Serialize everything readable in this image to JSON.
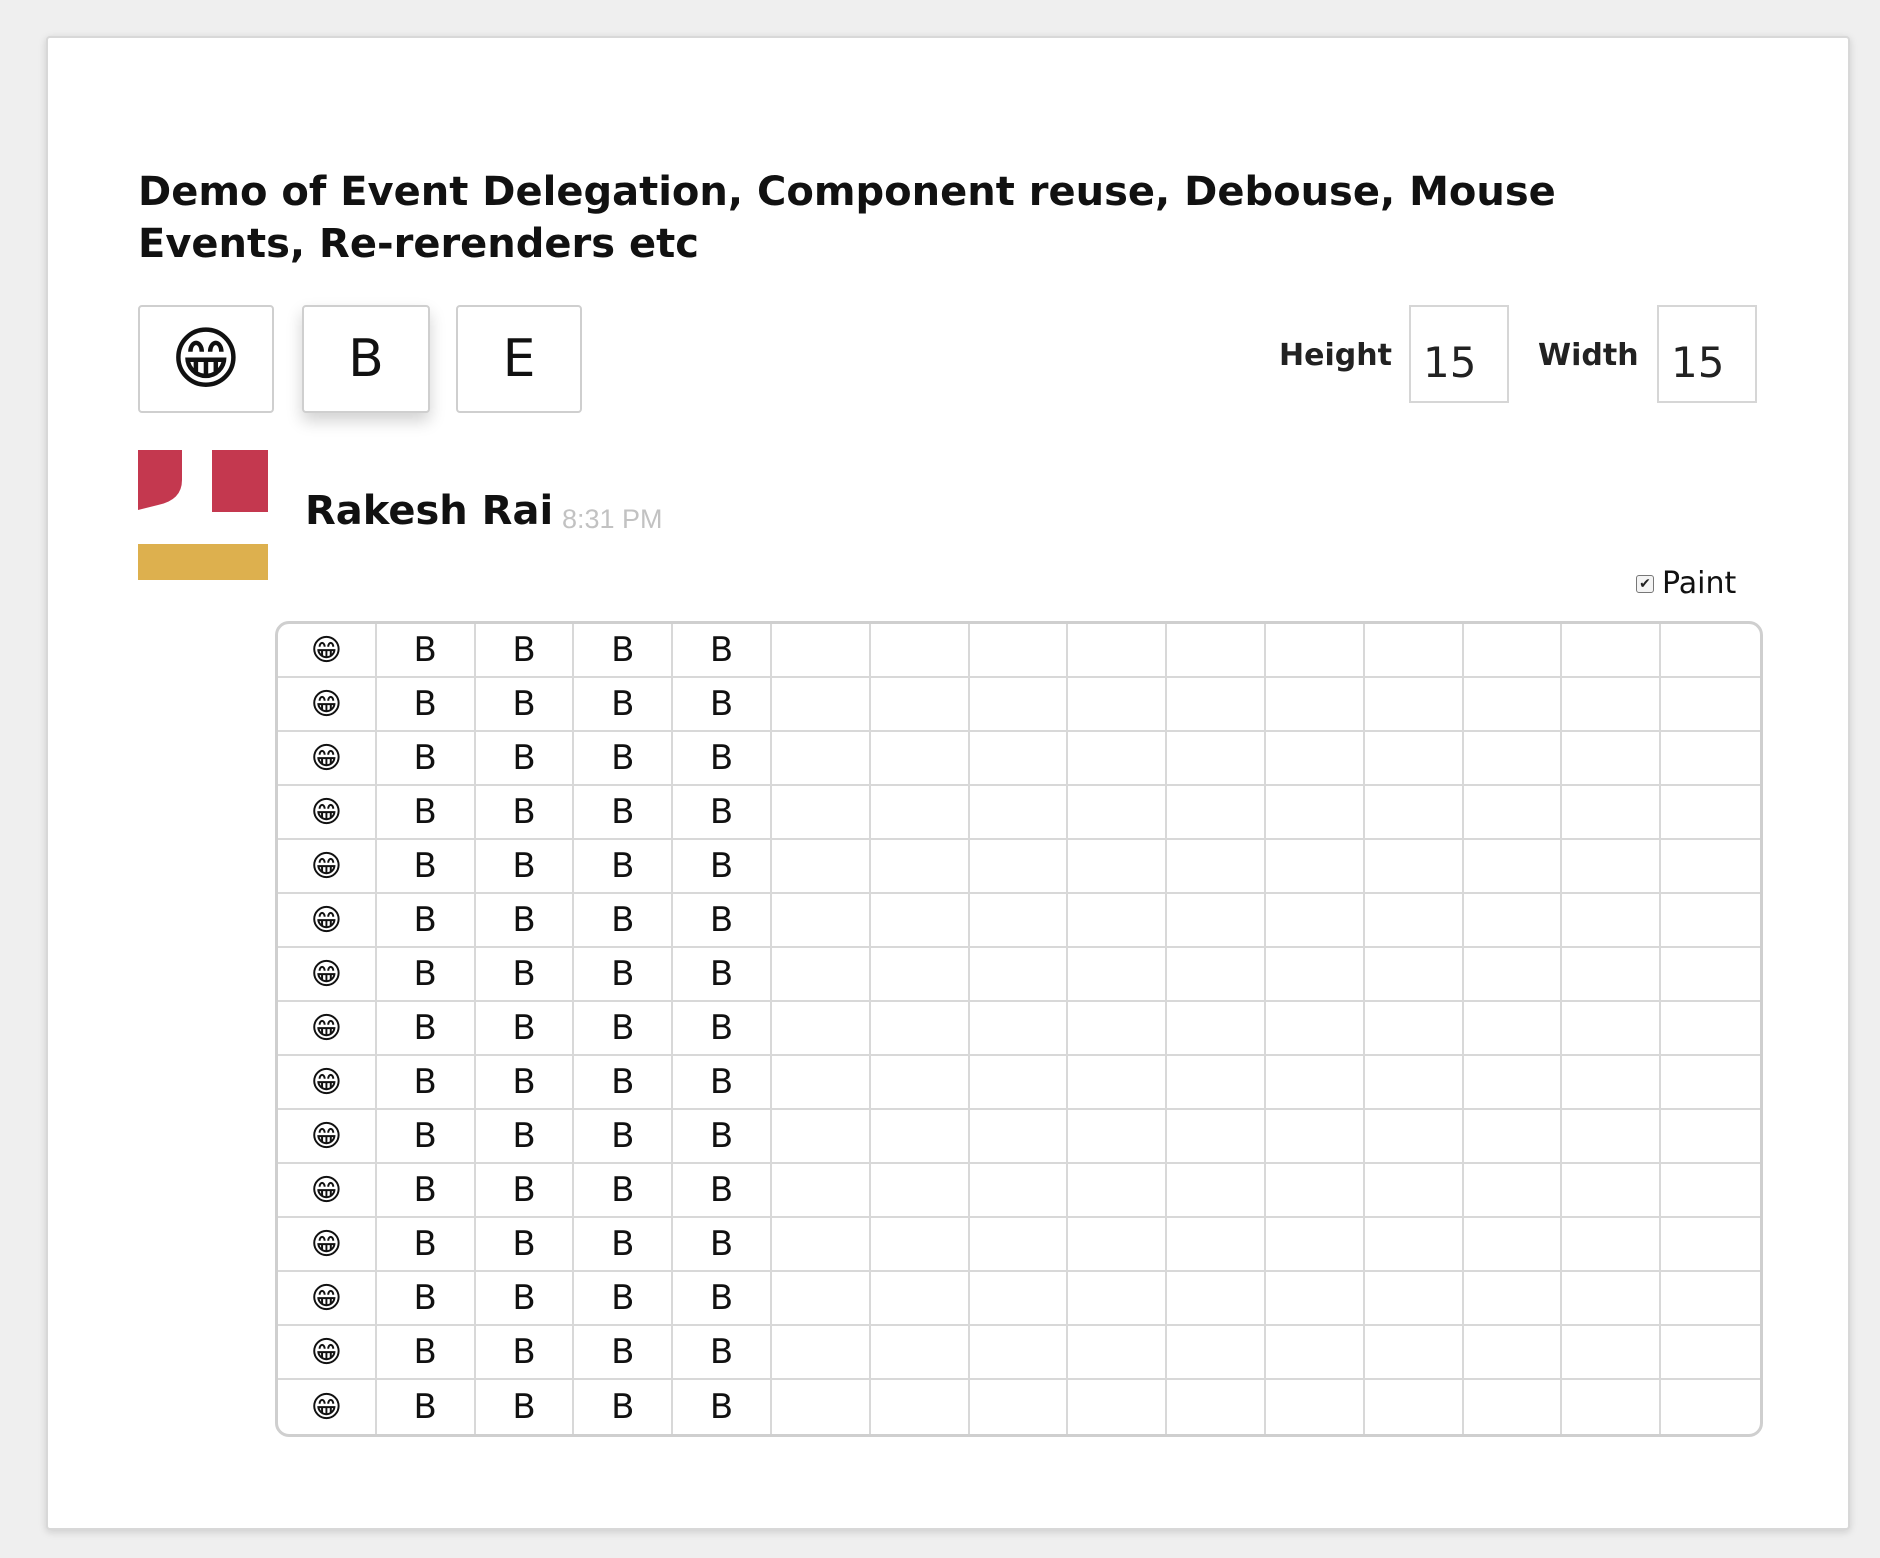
{
  "page": {
    "title": "Demo of Event Delegation, Component reuse, Debouse, Mouse Events, Re-rerenders etc"
  },
  "toolbar": {
    "emoji_label": "😁",
    "b_label": "B",
    "e_label": "E"
  },
  "dimensions": {
    "height_label": "Height",
    "height_value": "15",
    "width_label": "Width",
    "width_value": "15"
  },
  "message": {
    "user_name": "Rakesh Rai",
    "timestamp": "8:31 PM"
  },
  "paint": {
    "label": "Paint",
    "checked": true
  },
  "grid": {
    "rows": 15,
    "cols": 15,
    "cells": [
      [
        "😁",
        "B",
        "B",
        "B",
        "B",
        "",
        "",
        "",
        "",
        "",
        "",
        "",
        "",
        "",
        ""
      ],
      [
        "😁",
        "B",
        "B",
        "B",
        "B",
        "",
        "",
        "",
        "",
        "",
        "",
        "",
        "",
        "",
        ""
      ],
      [
        "😁",
        "B",
        "B",
        "B",
        "B",
        "",
        "",
        "",
        "",
        "",
        "",
        "",
        "",
        "",
        ""
      ],
      [
        "😁",
        "B",
        "B",
        "B",
        "B",
        "",
        "",
        "",
        "",
        "",
        "",
        "",
        "",
        "",
        ""
      ],
      [
        "😁",
        "B",
        "B",
        "B",
        "B",
        "",
        "",
        "",
        "",
        "",
        "",
        "",
        "",
        "",
        ""
      ],
      [
        "😁",
        "B",
        "B",
        "B",
        "B",
        "",
        "",
        "",
        "",
        "",
        "",
        "",
        "",
        "",
        ""
      ],
      [
        "😁",
        "B",
        "B",
        "B",
        "B",
        "",
        "",
        "",
        "",
        "",
        "",
        "",
        "",
        "",
        ""
      ],
      [
        "😁",
        "B",
        "B",
        "B",
        "B",
        "",
        "",
        "",
        "",
        "",
        "",
        "",
        "",
        "",
        ""
      ],
      [
        "😁",
        "B",
        "B",
        "B",
        "B",
        "",
        "",
        "",
        "",
        "",
        "",
        "",
        "",
        "",
        ""
      ],
      [
        "😁",
        "B",
        "B",
        "B",
        "B",
        "",
        "",
        "",
        "",
        "",
        "",
        "",
        "",
        "",
        ""
      ],
      [
        "😁",
        "B",
        "B",
        "B",
        "B",
        "",
        "",
        "",
        "",
        "",
        "",
        "",
        "",
        "",
        ""
      ],
      [
        "😁",
        "B",
        "B",
        "B",
        "B",
        "",
        "",
        "",
        "",
        "",
        "",
        "",
        "",
        "",
        ""
      ],
      [
        "😁",
        "B",
        "B",
        "B",
        "B",
        "",
        "",
        "",
        "",
        "",
        "",
        "",
        "",
        "",
        ""
      ],
      [
        "😁",
        "B",
        "B",
        "B",
        "B",
        "",
        "",
        "",
        "",
        "",
        "",
        "",
        "",
        "",
        ""
      ],
      [
        "😁",
        "B",
        "B",
        "B",
        "B",
        "",
        "",
        "",
        "",
        "",
        "",
        "",
        "",
        "",
        ""
      ]
    ]
  },
  "colors": {
    "avatar_red": "#c4384f",
    "avatar_gold": "#ddb04e",
    "grid_border": "#cfcfcf"
  }
}
